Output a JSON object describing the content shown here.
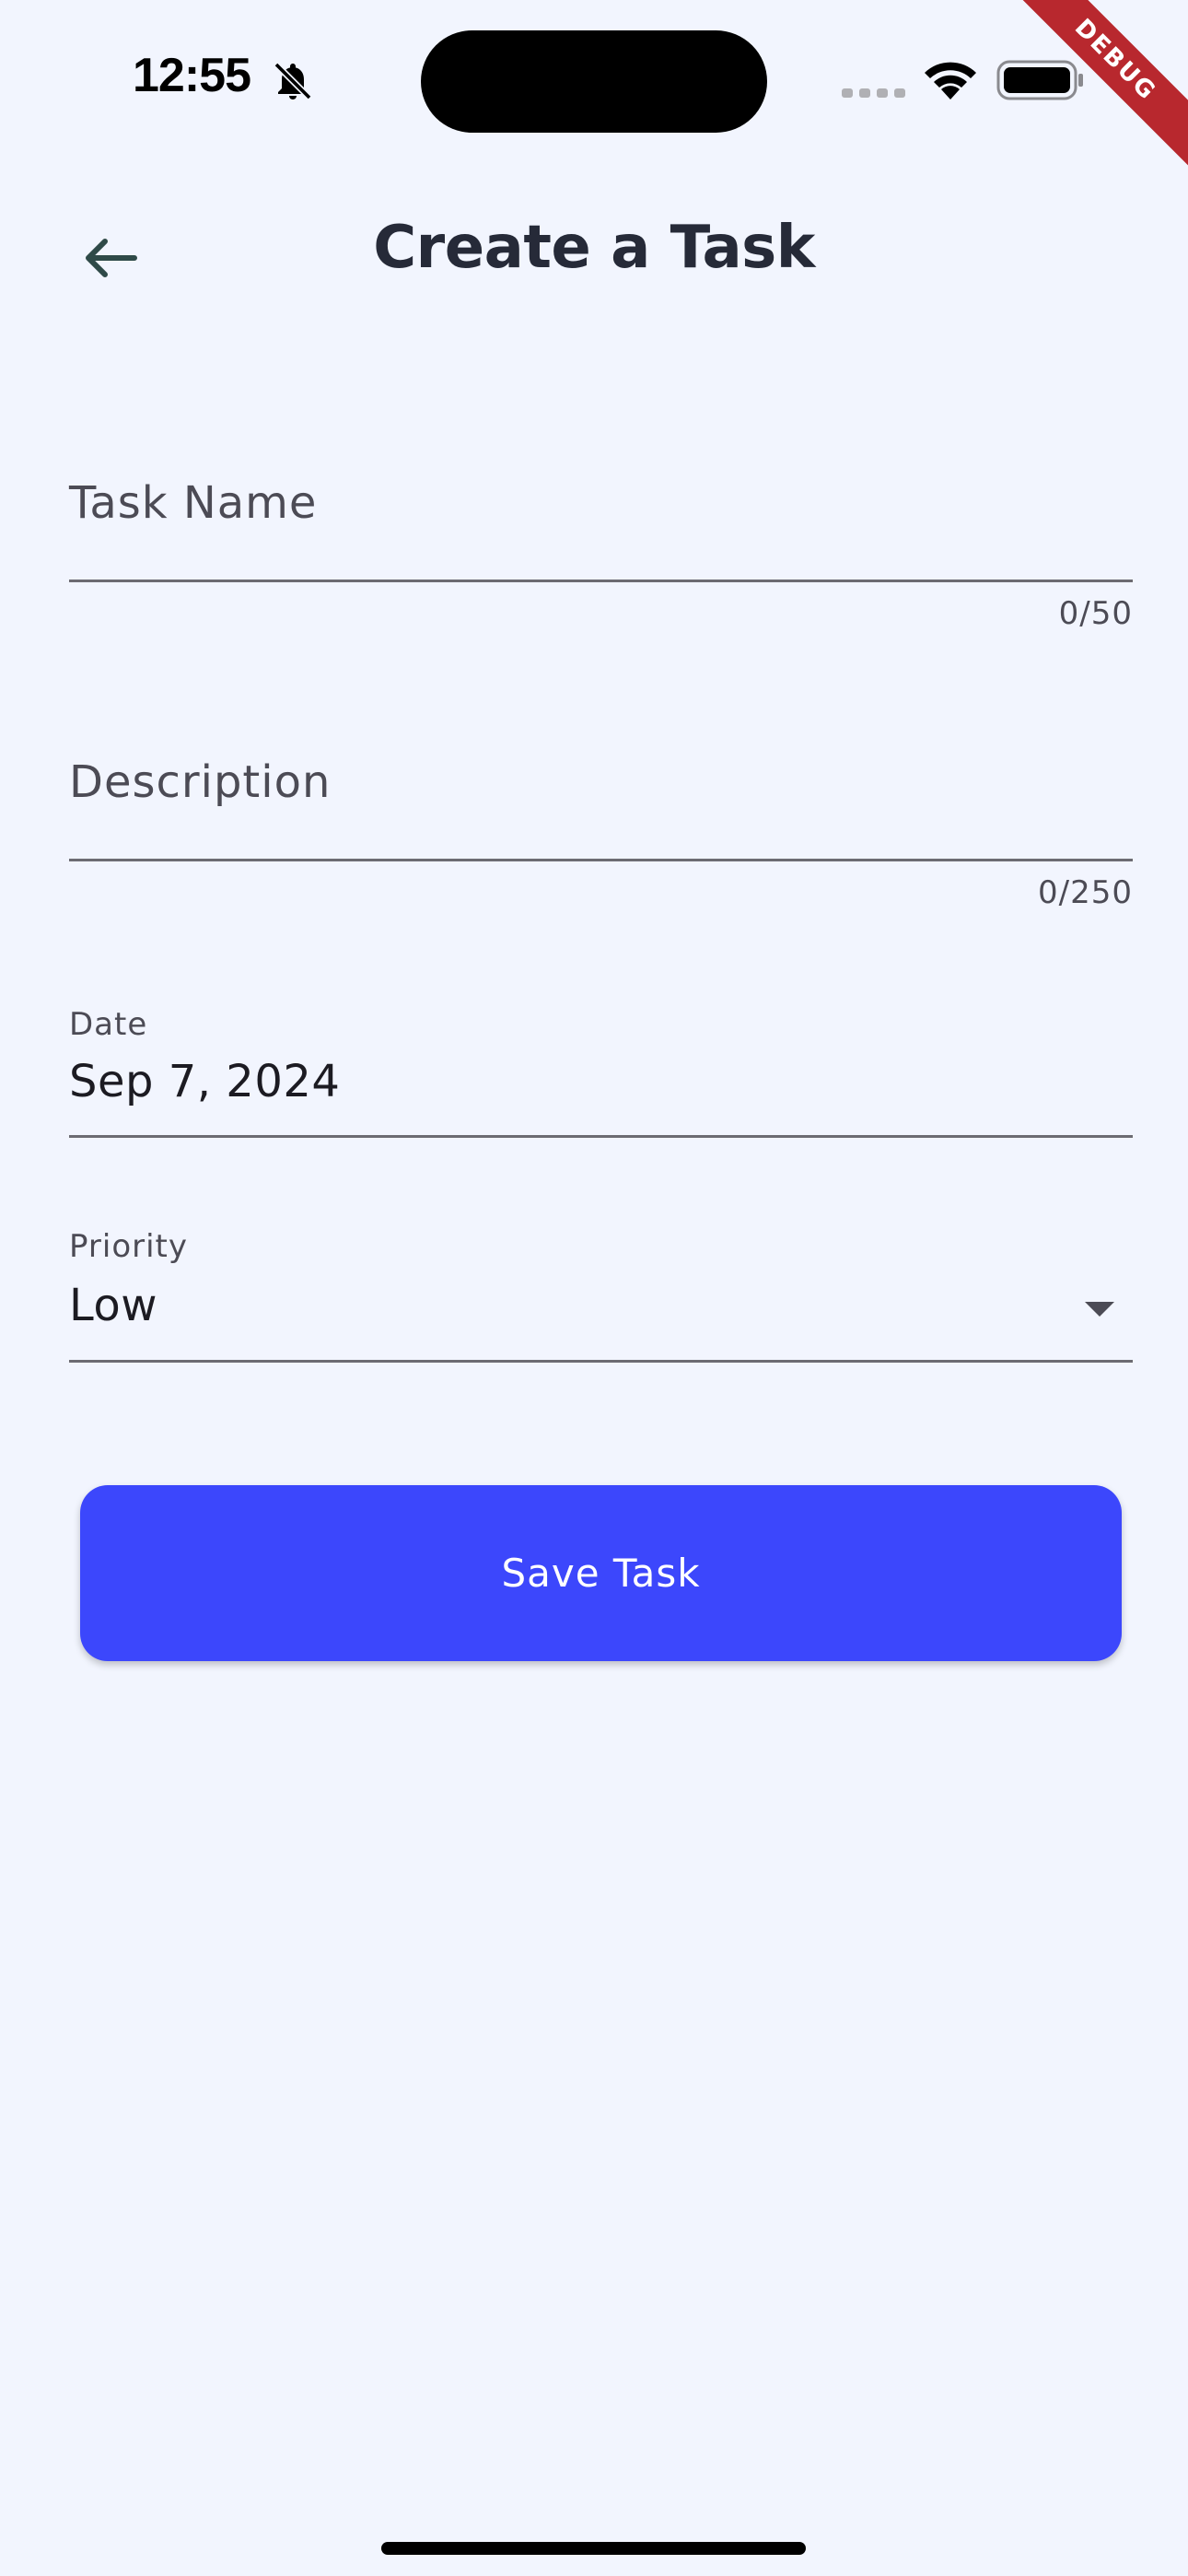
{
  "status_bar": {
    "time": "12:55"
  },
  "debug_banner": "DEBUG",
  "header": {
    "title": "Create a Task"
  },
  "form": {
    "task_name": {
      "placeholder": "Task Name",
      "counter": "0/50"
    },
    "description": {
      "placeholder": "Description",
      "counter": "0/250"
    },
    "date": {
      "label": "Date",
      "value": "Sep 7, 2024"
    },
    "priority": {
      "label": "Priority",
      "value": "Low"
    }
  },
  "actions": {
    "save_label": "Save Task"
  },
  "colors": {
    "background": "#f2f5fe",
    "accent": "#3c47fc",
    "debug": "#b8282e"
  }
}
